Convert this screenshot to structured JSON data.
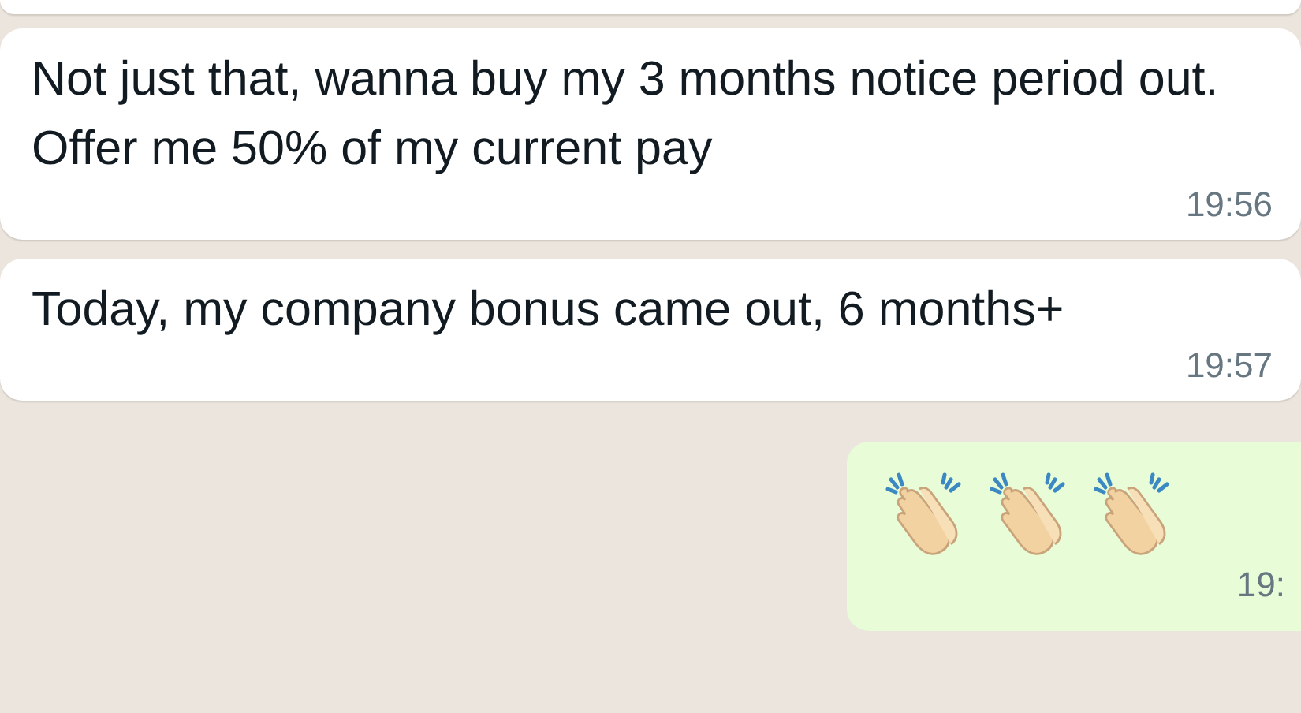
{
  "messages": [
    {
      "kind": "incoming",
      "text": "Not just that, wanna buy my 3 months notice period out. Offer me 50% of my current pay",
      "time": "19:56"
    },
    {
      "kind": "incoming",
      "text": "Today, my company bonus came out, 6 months+",
      "time": "19:57"
    },
    {
      "kind": "outgoing",
      "content": [
        {
          "kind": "clap"
        },
        {
          "kind": "clap"
        },
        {
          "kind": "clap"
        }
      ],
      "time": "19:"
    }
  ]
}
